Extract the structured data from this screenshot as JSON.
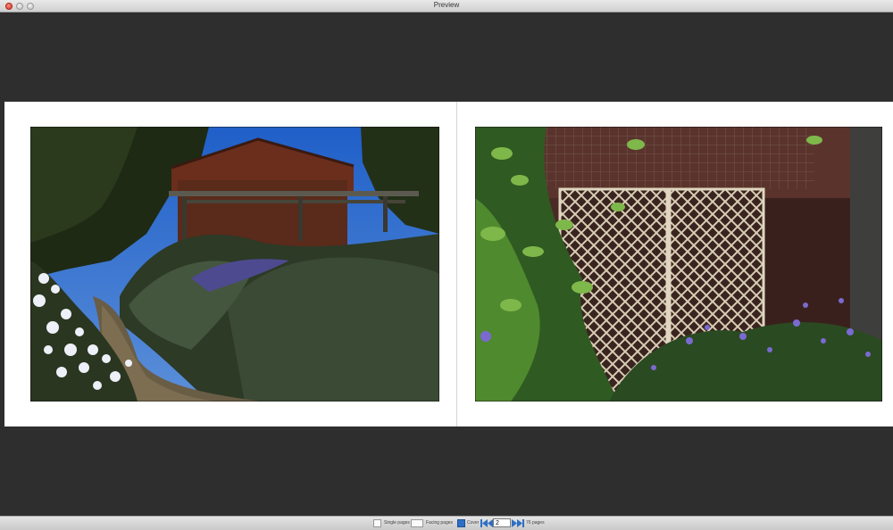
{
  "window": {
    "title": "Preview"
  },
  "bottombar": {
    "single_pages_label": "Single pages",
    "facing_pages_label": "Facing pages",
    "cover_label": "Cover",
    "current_page": "2",
    "total_pages": "76 pages"
  },
  "colors": {
    "background": "#2e2e2e",
    "page": "#ffffff",
    "nav_blue": "#2e6fc4"
  },
  "icons": [
    "first-page-icon",
    "prev-page-icon",
    "next-page-icon",
    "last-page-icon",
    "cover-icon"
  ]
}
